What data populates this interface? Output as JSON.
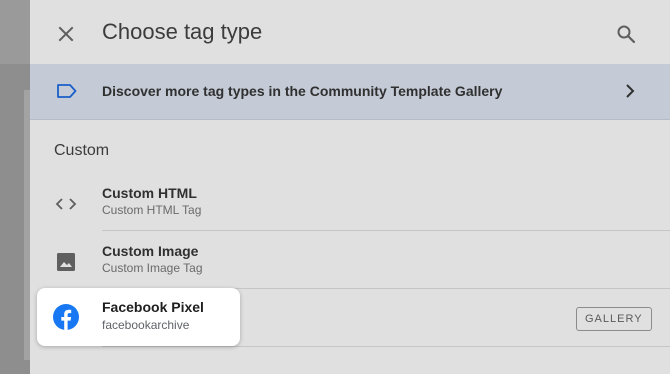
{
  "header": {
    "title": "Choose tag type",
    "close_icon": "close-icon",
    "search_icon": "search-icon"
  },
  "banner": {
    "text": "Discover more tag types in the Community Template Gallery",
    "icon": "label-tag-icon",
    "chevron": "chevron-right-icon",
    "color": "#c4cbd6"
  },
  "section": {
    "title": "Custom"
  },
  "items": [
    {
      "name": "Custom HTML",
      "sub": "Custom HTML Tag",
      "icon": "code-icon"
    },
    {
      "name": "Custom Image",
      "sub": "Custom Image Tag",
      "icon": "image-icon"
    },
    {
      "name": "Facebook Pixel",
      "sub": "facebookarchive",
      "icon": "facebook-icon",
      "badge": "GALLERY"
    }
  ],
  "colors": {
    "accent_blue": "#1a73e8",
    "facebook_blue": "#1877f2"
  }
}
